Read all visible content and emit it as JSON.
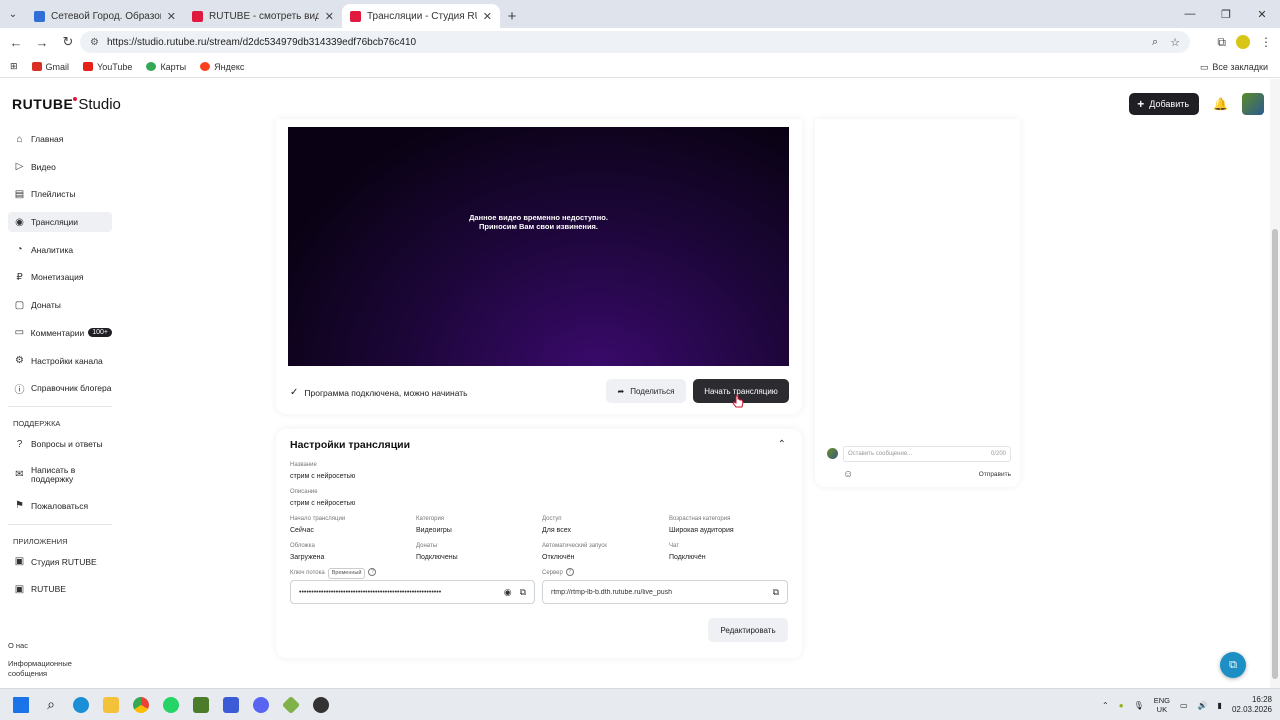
{
  "browser": {
    "tabs": [
      {
        "label": "Сетевой Город. Образование",
        "fav_color": "#2f6fd6",
        "active": false
      },
      {
        "label": "RUTUBE - смотреть видео онлайн",
        "fav_color": "#e0193f",
        "active": false
      },
      {
        "label": "Трансляции - Студия RUTUBE",
        "fav_color": "#e0193f",
        "active": true
      }
    ],
    "url": "https://studio.rutube.ru/stream/d2dc534979db314339edf76bcb76c410",
    "bookmarks": [
      {
        "label": "Gmail",
        "color": "#d93025"
      },
      {
        "label": "YouTube",
        "color": "#e62117"
      },
      {
        "label": "Карты",
        "color": "#34a853"
      },
      {
        "label": "Яндекс",
        "color": "#fc3f1d"
      }
    ],
    "all_bookmarks": "Все закладки"
  },
  "studio": {
    "logo_main": "RUTUBE",
    "logo_sub": "Studio",
    "add_button": "Добавить"
  },
  "sidebar": {
    "items": [
      {
        "label": "Главная"
      },
      {
        "label": "Видео"
      },
      {
        "label": "Плейлисты"
      },
      {
        "label": "Трансляции"
      },
      {
        "label": "Аналитика"
      },
      {
        "label": "Монетизация"
      },
      {
        "label": "Донаты"
      },
      {
        "label": "Комментарии",
        "badge": "100+"
      },
      {
        "label": "Настройки канала"
      },
      {
        "label": "Справочник блогера"
      }
    ],
    "support_title": "ПОДДЕРЖКА",
    "support_items": [
      {
        "label": "Вопросы и ответы"
      },
      {
        "label": "Написать в поддержку"
      },
      {
        "label": "Пожаловаться"
      }
    ],
    "apps_title": "ПРИЛОЖЕНИЯ",
    "apps_items": [
      {
        "label": "Студия RUTUBE"
      },
      {
        "label": "RUTUBE"
      }
    ],
    "footer": [
      "О нас",
      "Информационные сообщения"
    ]
  },
  "player": {
    "message_line1": "Данное видео временно недоступно.",
    "message_line2": "Приносим Вам свои извинения.",
    "status": "Программа подключена, можно начинать",
    "share_button": "Поделиться",
    "start_button": "Начать трансляцию"
  },
  "settings": {
    "title": "Настройки трансляции",
    "name_label": "Название",
    "name_value": "стрим с нейросетью",
    "desc_label": "Описание",
    "desc_value": "стрим с нейросетью",
    "grid": [
      {
        "label": "Начало трансляции",
        "value": "Сейчас"
      },
      {
        "label": "Категория",
        "value": "Видеоигры"
      },
      {
        "label": "Доступ",
        "value": "Для всех"
      },
      {
        "label": "Возрастная категория",
        "value": "Широкая аудитория"
      },
      {
        "label": "Обложка",
        "value": "Загружена"
      },
      {
        "label": "Донаты",
        "value": "Подключены"
      },
      {
        "label": "Автоматический запуск",
        "value": "Отключён"
      },
      {
        "label": "Чат",
        "value": "Подключён"
      }
    ],
    "stream_key_label": "Ключ потока",
    "stream_key_tag": "Временный",
    "stream_key_value": "••••••••••••••••••••••••••••••••••••••••••••••••••••••••••",
    "server_label": "Сервер",
    "server_value": "rtmp://rtmp-lb-b.dth.rutube.ru/live_push",
    "edit_button": "Редактировать"
  },
  "chat": {
    "placeholder": "Оставить сообщение...",
    "counter": "0/200",
    "send": "Отправить"
  },
  "taskbar": {
    "lang_1": "ENG",
    "lang_2": "UK",
    "time": "16:28",
    "date": "02.03.2026"
  }
}
